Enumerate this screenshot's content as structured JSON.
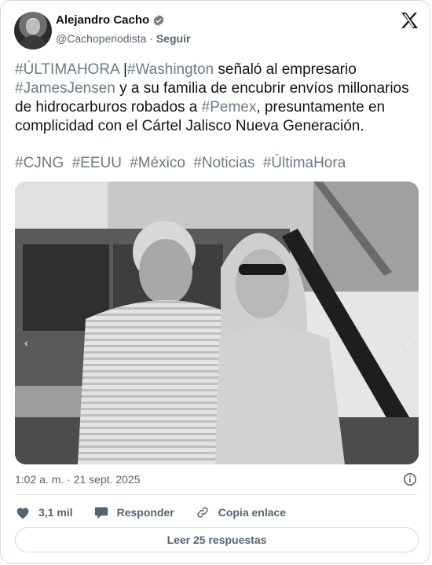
{
  "author": {
    "display_name": "Alejandro Cacho",
    "handle": "@Cachoperiodista",
    "separator": "·",
    "follow_label": "Seguir"
  },
  "tweet": {
    "line1_tag1": "#ÚLTIMAHORA",
    "line1_sep": " |",
    "line1_tag2": "#Washington",
    "line1_rest": " señaló al empresario",
    "line2_tag": "#JamesJensen",
    "line2_rest": " y a su familia de encubrir envíos millonarios",
    "line3_start": "de hidrocarburos robados a ",
    "line3_tag": "#Pemex",
    "line3_rest": ", presuntamente en",
    "line4": "complicidad con el Cártel Jalisco Nueva Generación.",
    "hashtags": [
      "#CJNG",
      "#EEUU",
      "#México",
      "#Noticias",
      "#ÚltimaHora"
    ]
  },
  "timestamp": "1:02 a. m. · 21 sept. 2025",
  "actions": {
    "likes": "3,1 mil",
    "reply_label": "Responder",
    "copy_label": "Copia enlace"
  },
  "read_replies": "Leer 25 respuestas",
  "colors": {
    "text": "#0f1419",
    "muted": "#536471",
    "hashtag": "#6b7a87",
    "border": "#cfd9de"
  }
}
